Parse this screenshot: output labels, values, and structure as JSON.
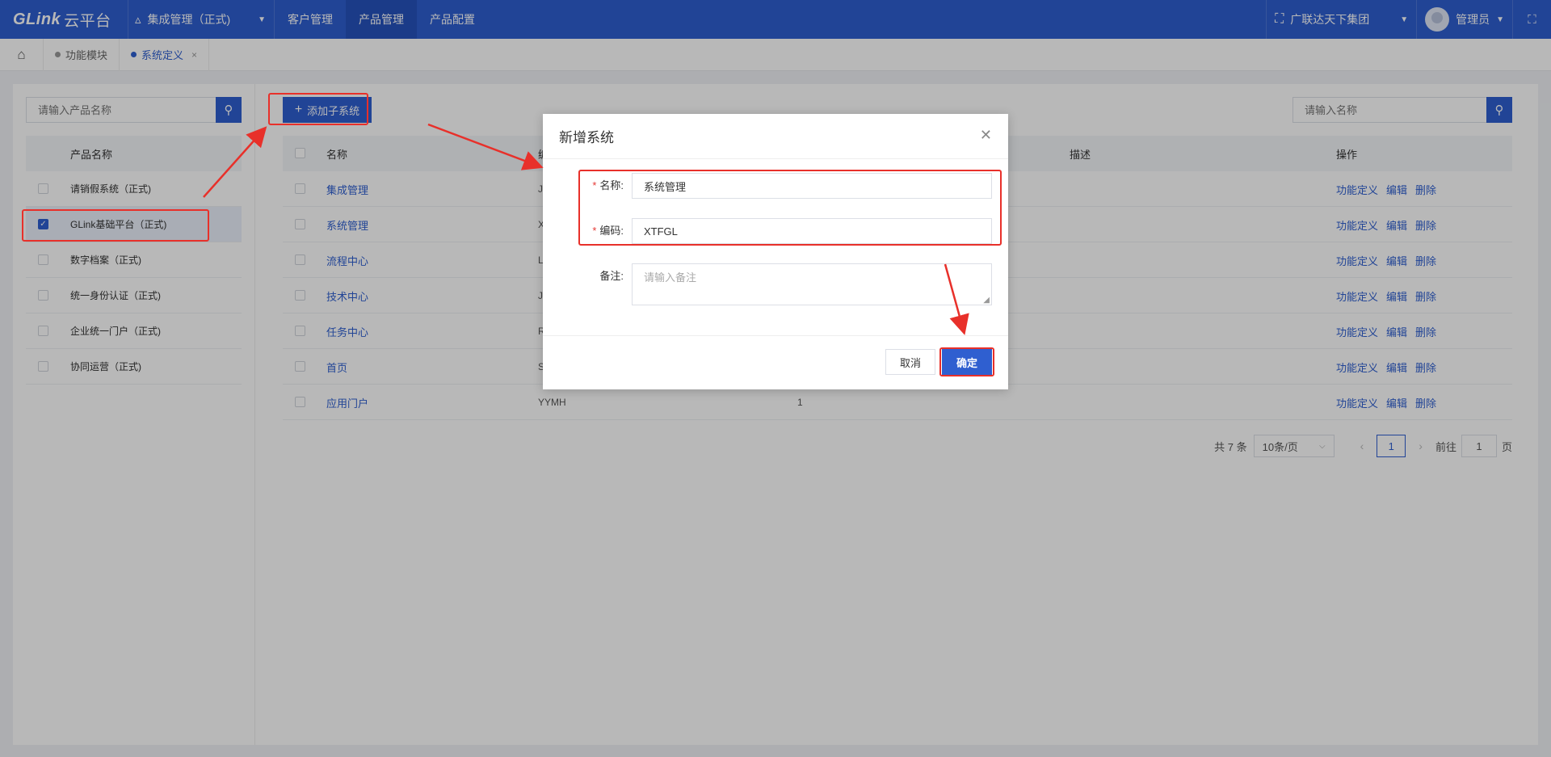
{
  "app": {
    "logo_main": "GLink",
    "logo_sub": "云平台",
    "system_select": "集成管理（正式)",
    "nav": [
      "客户管理",
      "产品管理",
      "产品配置"
    ],
    "org": "广联达天下集团",
    "user": "管理员"
  },
  "tabs": [
    "功能模块",
    "系统定义"
  ],
  "left": {
    "search_placeholder": "请输入产品名称",
    "header": "产品名称",
    "items": [
      {
        "label": "请销假系统（正式)",
        "checked": false
      },
      {
        "label": "GLink基础平台（正式)",
        "checked": true
      },
      {
        "label": "数字档案（正式)",
        "checked": false
      },
      {
        "label": "统一身份认证（正式)",
        "checked": false
      },
      {
        "label": "企业统一门户（正式)",
        "checked": false
      },
      {
        "label": "协同运营（正式)",
        "checked": false
      }
    ]
  },
  "right": {
    "add_button": "添加子系统",
    "search_placeholder": "请输入名称",
    "columns": [
      "名称",
      "编码",
      "描述",
      "操作"
    ],
    "rows": [
      {
        "name": "集成管理",
        "code": "JCG",
        "num": ""
      },
      {
        "name": "系统管理",
        "code": "XTG",
        "num": ""
      },
      {
        "name": "流程中心",
        "code": "LCZ",
        "num": ""
      },
      {
        "name": "技术中心",
        "code": "JSZX",
        "num": ""
      },
      {
        "name": "任务中心",
        "code": "RWZ",
        "num": ""
      },
      {
        "name": "首页",
        "code": "SY",
        "num": ""
      },
      {
        "name": "应用门户",
        "code": "YYMH",
        "num": "1"
      }
    ],
    "ops": [
      "功能定义",
      "编辑",
      "删除"
    ],
    "pager": {
      "total": "共 7 条",
      "page_size": "10条/页",
      "current": "1",
      "goto_label": "前往",
      "goto_value": "1",
      "page_suffix": "页"
    }
  },
  "modal": {
    "title": "新增系统",
    "name_label": "名称:",
    "name_value": "系统管理",
    "code_label": "编码:",
    "code_value": "XTFGL",
    "remark_label": "备注:",
    "remark_placeholder": "请输入备注",
    "cancel": "取消",
    "ok": "确定"
  },
  "colors": {
    "primary": "#2f5fd0",
    "annotation": "#e8302a"
  }
}
